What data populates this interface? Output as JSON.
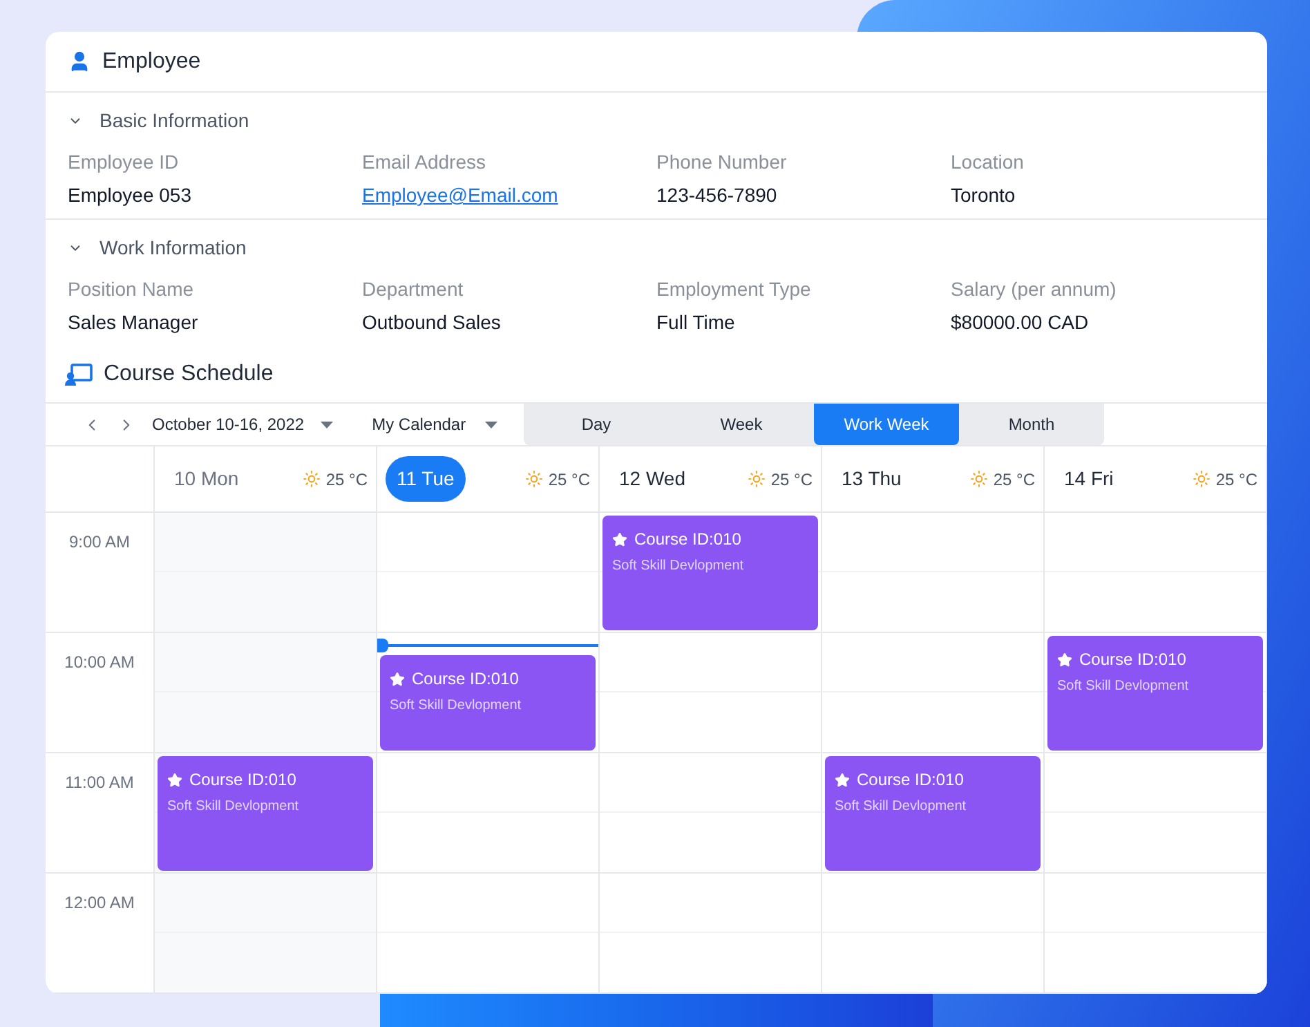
{
  "header": {
    "title": "Employee"
  },
  "sections": [
    {
      "title": "Basic Information",
      "expanded": true,
      "fields": [
        {
          "label": "Employee ID",
          "value": "Employee 053",
          "kind": "text"
        },
        {
          "label": "Email Address",
          "value": "Employee@Email.com",
          "kind": "link"
        },
        {
          "label": "Phone Number",
          "value": "123-456-7890",
          "kind": "text"
        },
        {
          "label": "Location",
          "value": "Toronto",
          "kind": "text"
        }
      ]
    },
    {
      "title": "Work Information",
      "expanded": true,
      "fields": [
        {
          "label": "Position Name",
          "value": "Sales Manager",
          "kind": "text"
        },
        {
          "label": "Department",
          "value": "Outbound Sales",
          "kind": "text"
        },
        {
          "label": "Employment Type",
          "value": "Full Time",
          "kind": "text"
        },
        {
          "label": "Salary (per annum)",
          "value": "$80000.00 CAD",
          "kind": "text"
        }
      ]
    }
  ],
  "schedule": {
    "title": "Course Schedule",
    "date_range": "October 10-16, 2022",
    "calendar": "My Calendar",
    "views": [
      {
        "label": "Day",
        "selected": false
      },
      {
        "label": "Week",
        "selected": false
      },
      {
        "label": "Work Week",
        "selected": true
      },
      {
        "label": "Month",
        "selected": false
      }
    ],
    "times": [
      "9:00 AM",
      "10:00 AM",
      "11:00 AM",
      "12:00 AM"
    ],
    "days": [
      {
        "label": "10 Mon",
        "temp": "25 °C",
        "selected": false,
        "past": true,
        "events": [
          {
            "title": "Course ID:010",
            "subtitle": "Soft Skill Devlopment",
            "kind": "eleven"
          }
        ]
      },
      {
        "label": "11 Tue",
        "temp": "25 °C",
        "selected": true,
        "past": false,
        "events": [
          {
            "title": "Course ID:010",
            "subtitle": "Soft Skill Devlopment",
            "kind": "tenlate"
          }
        ]
      },
      {
        "label": "12 Wed",
        "temp": "25 °C",
        "selected": false,
        "past": false,
        "events": [
          {
            "title": "Course ID:010",
            "subtitle": "Soft Skill Devlopment",
            "kind": "nine"
          }
        ]
      },
      {
        "label": "13 Thu",
        "temp": "25 °C",
        "selected": false,
        "past": false,
        "events": [
          {
            "title": "Course ID:010",
            "subtitle": "Soft Skill Devlopment",
            "kind": "eleven"
          }
        ]
      },
      {
        "label": "14 Fri",
        "temp": "25 °C",
        "selected": false,
        "past": false,
        "events": [
          {
            "title": "Course ID:010",
            "subtitle": "Soft Skill Devlopment",
            "kind": "ten"
          }
        ]
      }
    ]
  }
}
